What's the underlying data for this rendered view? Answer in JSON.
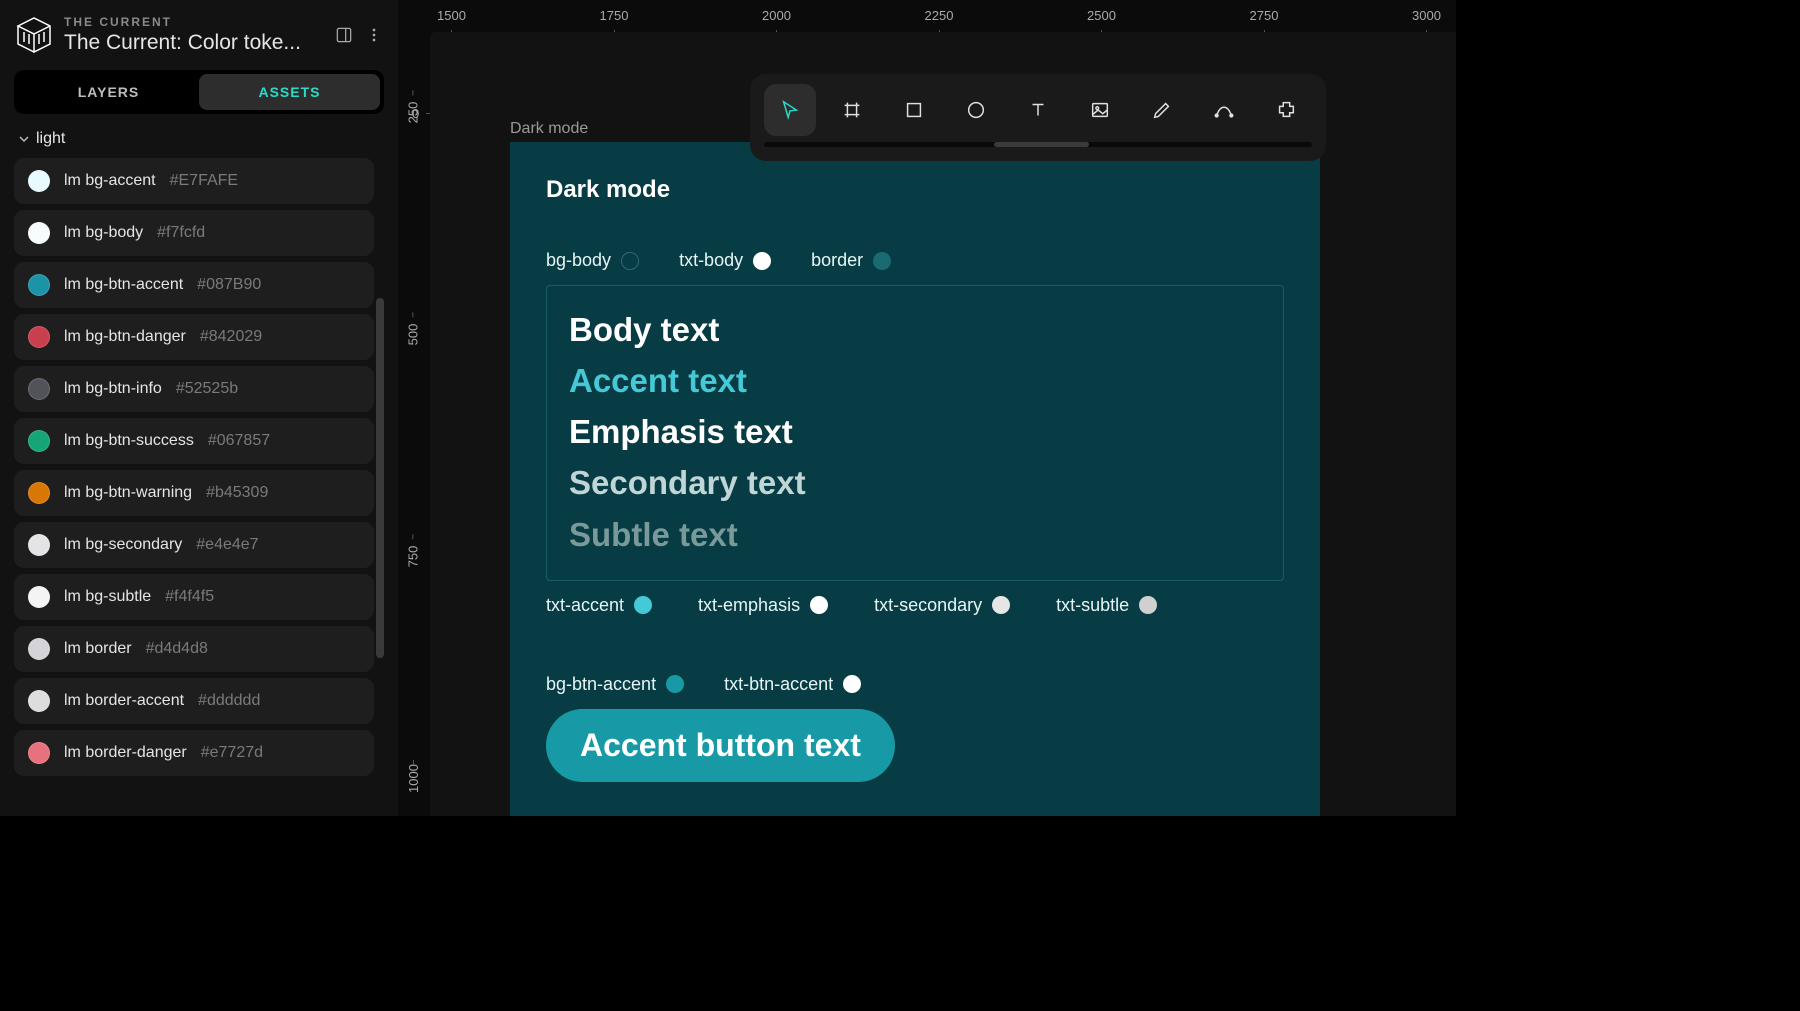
{
  "header": {
    "brand": "THE CURRENT",
    "doc_title": "The Current: Color toke..."
  },
  "tabs": {
    "layers": "LAYERS",
    "assets": "ASSETS"
  },
  "section": {
    "name": "light"
  },
  "assets": [
    {
      "name": "lm bg-accent",
      "hex": "#E7FAFE",
      "swatch": "#E7FAFE"
    },
    {
      "name": "lm bg-body",
      "hex": "#f7fcfd",
      "swatch": "#f7fcfd"
    },
    {
      "name": "lm bg-btn-accent",
      "hex": "#087B90",
      "swatch": "#1c93a6"
    },
    {
      "name": "lm bg-btn-danger",
      "hex": "#842029",
      "swatch": "#c83f4d"
    },
    {
      "name": "lm bg-btn-info",
      "hex": "#52525b",
      "swatch": "#52525b"
    },
    {
      "name": "lm bg-btn-success",
      "hex": "#067857",
      "swatch": "#16a577"
    },
    {
      "name": "lm bg-btn-warning",
      "hex": "#b45309",
      "swatch": "#d97706"
    },
    {
      "name": "lm bg-secondary",
      "hex": "#e4e4e7",
      "swatch": "#e4e4e7"
    },
    {
      "name": "lm bg-subtle",
      "hex": "#f4f4f5",
      "swatch": "#f4f4f5"
    },
    {
      "name": "lm border",
      "hex": "#d4d4d8",
      "swatch": "#d4d4d8"
    },
    {
      "name": "lm border-accent",
      "hex": "#dddddd",
      "swatch": "#dddddd"
    },
    {
      "name": "lm border-danger",
      "hex": "#e7727d",
      "swatch": "#e7727d"
    }
  ],
  "ruler_top": [
    "1500",
    "1750",
    "2000",
    "2250",
    "2500",
    "2750",
    "3000"
  ],
  "ruler_left_zero": "0",
  "ruler_left": [
    "250",
    "500",
    "750",
    "1000"
  ],
  "canvas": {
    "frame_label": "Dark mode",
    "frame_title": "Dark mode",
    "labels_top": [
      {
        "name": "bg-body",
        "chip": "#083c44",
        "outline": true
      },
      {
        "name": "txt-body",
        "chip": "#ffffff"
      },
      {
        "name": "border",
        "chip": "#1a6a72"
      }
    ],
    "text_samples": {
      "body": "Body text",
      "accent": "Accent text",
      "emphasis": "Emphasis text",
      "secondary": "Secondary text",
      "subtle": "Subtle text"
    },
    "labels_mid": [
      {
        "name": "txt-accent",
        "chip": "#45c9d6"
      },
      {
        "name": "txt-emphasis",
        "chip": "#ffffff"
      },
      {
        "name": "txt-secondary",
        "chip": "#e6e6e6"
      },
      {
        "name": "txt-subtle",
        "chip": "#d0d0d0"
      }
    ],
    "labels_btn": [
      {
        "name": "bg-btn-accent",
        "chip": "#189aa6"
      },
      {
        "name": "txt-btn-accent",
        "chip": "#ffffff"
      }
    ],
    "button_text": "Accent button text"
  }
}
